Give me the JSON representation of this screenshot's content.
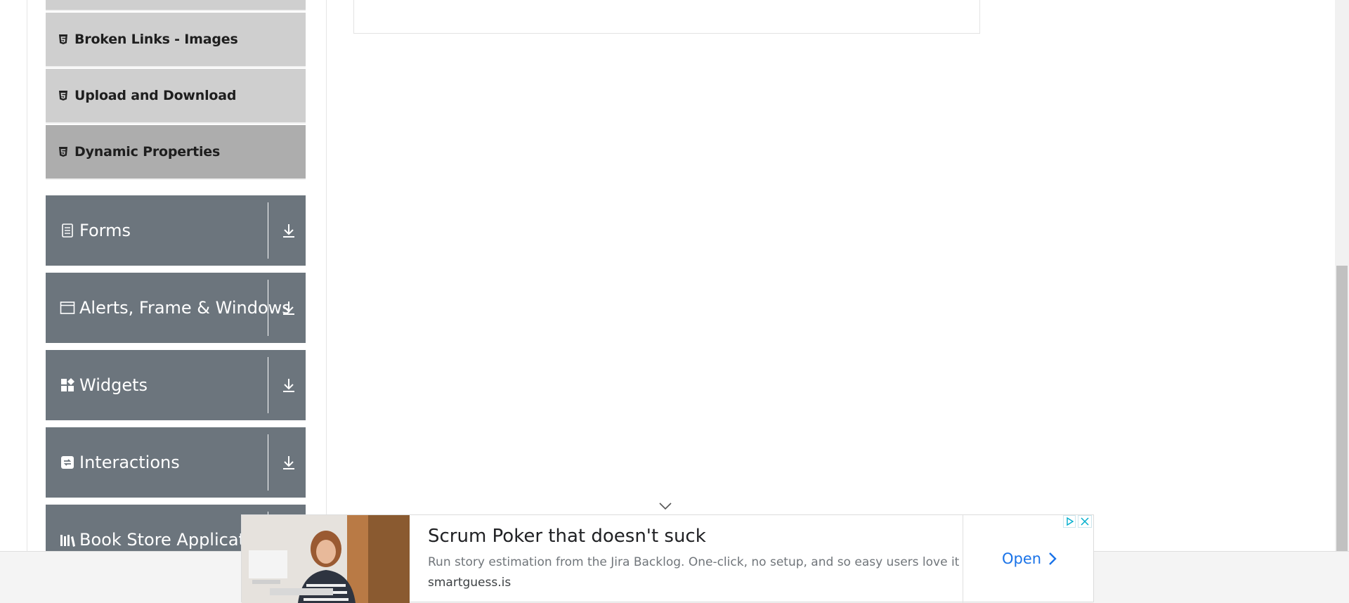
{
  "sidebar": {
    "sub_items": [
      {
        "label": "Broken Links - Images",
        "icon": "html5-icon"
      },
      {
        "label": "Upload and Download",
        "icon": "html5-icon"
      },
      {
        "label": "Dynamic Properties",
        "icon": "html5-icon",
        "active": true
      }
    ],
    "groups": [
      {
        "label": "Forms",
        "icon": "document-icon"
      },
      {
        "label": "Alerts, Frame & Windows",
        "icon": "window-icon"
      },
      {
        "label": "Widgets",
        "icon": "widgets-icon"
      },
      {
        "label": "Interactions",
        "icon": "interactions-icon"
      },
      {
        "label": "Book Store Application",
        "icon": "books-icon"
      }
    ]
  },
  "ad": {
    "title": "Scrum Poker that doesn't suck",
    "description": "Run story estimation from the Jira Backlog. One-click, no setup, and so easy users love it",
    "domain": "smartguess.is",
    "open_label": "Open",
    "accent_color": "#1a73e8"
  },
  "colors": {
    "group_bg": "#6c757d",
    "sub_item_bg": "#cfcfcf",
    "sub_item_active_bg": "#adadad"
  }
}
